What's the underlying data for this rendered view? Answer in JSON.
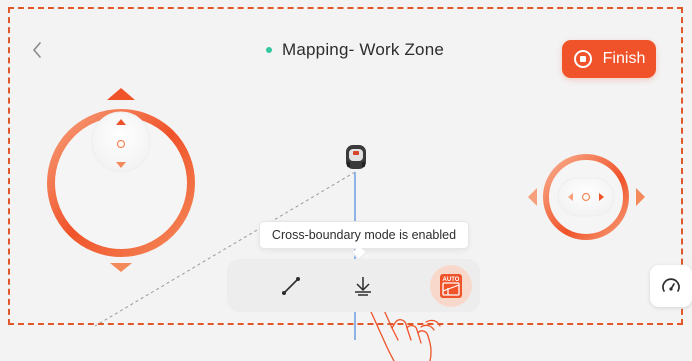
{
  "header": {
    "back_icon": "chevron-left-icon",
    "status_dot_color": "#33c7a0",
    "title": "Mapping- Work Zone",
    "finish_button": {
      "label": "Finish",
      "icon": "stop-circle-icon",
      "color": "#f0532a"
    }
  },
  "tooltip": {
    "text": "Cross-boundary mode is enabled"
  },
  "toolbar": {
    "items": [
      {
        "name": "line-tool",
        "icon": "line-draw-icon"
      },
      {
        "name": "anchor-point",
        "icon": "anchor-down-icon"
      },
      {
        "name": "auto-mode",
        "icon": "auto-icon",
        "badge": "AUTO"
      }
    ]
  },
  "joysticks": {
    "left": {
      "type": "vertical",
      "accent": "#f0532a"
    },
    "right": {
      "type": "horizontal",
      "accent": "#f0532a"
    }
  },
  "settings_button": {
    "icon": "speedometer-icon"
  },
  "frame_color": "#e0582a"
}
